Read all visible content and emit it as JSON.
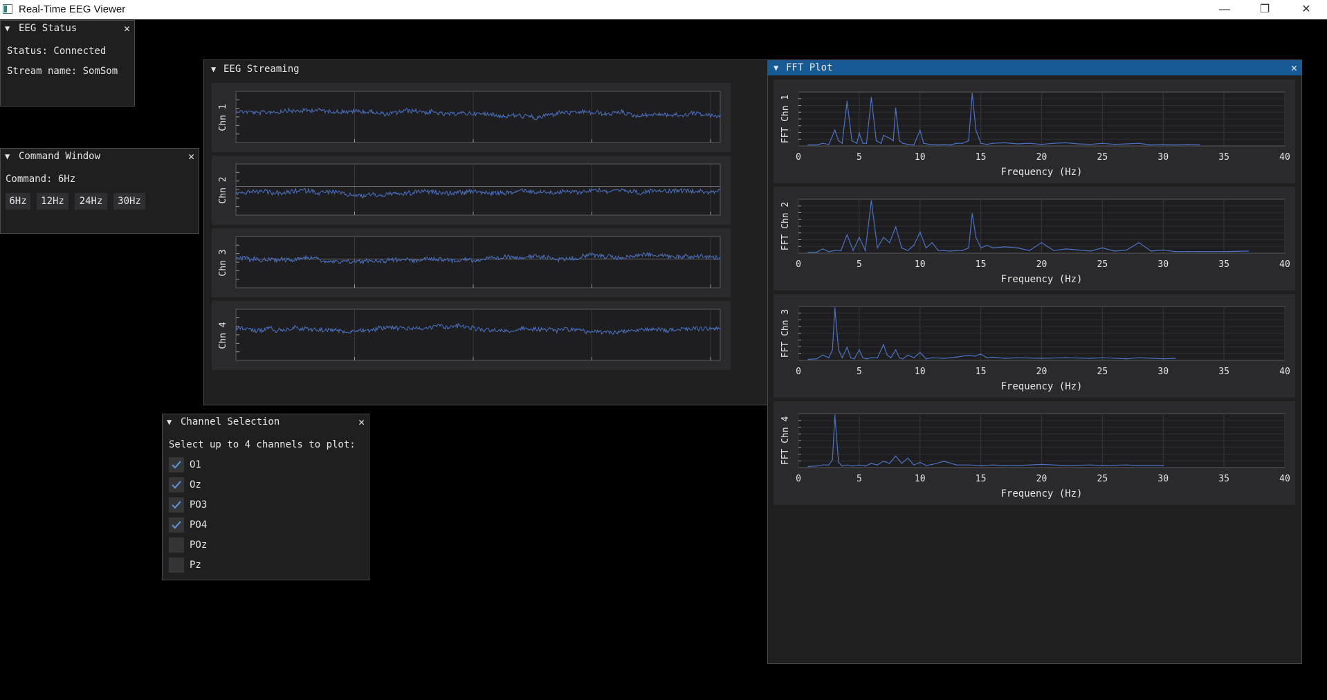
{
  "app": {
    "title": "Real-Time EEG Viewer"
  },
  "window_controls": {
    "minimize": "—",
    "restore": "❐",
    "close": "✕"
  },
  "eeg_status": {
    "title": "EEG Status",
    "status_text": "Status: Connected",
    "stream_text": "Stream name: SomSom"
  },
  "command_window": {
    "title": "Command Window",
    "command_text": "Command: 6Hz",
    "buttons": [
      "6Hz",
      "12Hz",
      "24Hz",
      "30Hz"
    ]
  },
  "eeg_streaming": {
    "title": "EEG Streaming",
    "channels": [
      "Chn 1",
      "Chn 2",
      "Chn 3",
      "Chn 4"
    ],
    "line_color": "#4c72c4"
  },
  "channel_selection": {
    "title": "Channel Selection",
    "prompt": "Select up to 4 channels to plot:",
    "channels": [
      {
        "label": "O1",
        "checked": true
      },
      {
        "label": "Oz",
        "checked": true
      },
      {
        "label": "PO3",
        "checked": true
      },
      {
        "label": "PO4",
        "checked": true
      },
      {
        "label": "POz",
        "checked": false
      },
      {
        "label": "Pz",
        "checked": false
      }
    ]
  },
  "fft_plot": {
    "title": "FFT Plot",
    "accent": "#185a93"
  },
  "chart_data": [
    {
      "type": "line",
      "ylabel": "FFT Chn 1",
      "xlabel": "Frequency (Hz)",
      "xlim": [
        0,
        40
      ],
      "xticks": [
        "0",
        "5",
        "10",
        "15",
        "20",
        "25",
        "30",
        "35",
        "40"
      ],
      "grid": true,
      "x": [
        0.8,
        1.5,
        2,
        2.5,
        3,
        3.3,
        3.6,
        4,
        4.4,
        4.8,
        5,
        5.3,
        5.6,
        6,
        6.4,
        6.8,
        7,
        7.5,
        7.8,
        8,
        8.3,
        8.6,
        9,
        9.5,
        10,
        10.3,
        10.8,
        11.5,
        12,
        12.5,
        13,
        13.5,
        14,
        14.3,
        14.6,
        15,
        15.5,
        16,
        17,
        18,
        19,
        20,
        21,
        22,
        23,
        24,
        25,
        26,
        27,
        28,
        29,
        30,
        31,
        32,
        33
      ],
      "y": [
        0.02,
        0.02,
        0.05,
        0.03,
        0.3,
        0.1,
        0.05,
        0.85,
        0.1,
        0.05,
        0.25,
        0.05,
        0.05,
        0.92,
        0.1,
        0.05,
        0.2,
        0.15,
        0.1,
        0.72,
        0.1,
        0.05,
        0.03,
        0.02,
        0.3,
        0.05,
        0.03,
        0.02,
        0.03,
        0.02,
        0.05,
        0.05,
        0.1,
        1.0,
        0.3,
        0.05,
        0.03,
        0.05,
        0.06,
        0.04,
        0.05,
        0.03,
        0.05,
        0.06,
        0.04,
        0.03,
        0.05,
        0.03,
        0.04,
        0.05,
        0.02,
        0.03,
        0.02,
        0.03,
        0.02
      ]
    },
    {
      "type": "line",
      "ylabel": "FFT Chn 2",
      "xlabel": "Frequency (Hz)",
      "xlim": [
        0,
        40
      ],
      "xticks": [
        "0",
        "5",
        "10",
        "15",
        "20",
        "25",
        "30",
        "35",
        "40"
      ],
      "grid": true,
      "x": [
        0.8,
        1.5,
        2,
        2.5,
        3,
        3.5,
        4,
        4.5,
        5,
        5.5,
        6,
        6.5,
        7,
        7.5,
        8,
        8.5,
        9,
        9.5,
        10,
        10.5,
        11,
        11.5,
        12,
        12.5,
        13,
        13.5,
        14,
        14.3,
        14.6,
        15,
        15.5,
        16,
        17,
        18,
        19,
        20,
        21,
        22,
        23,
        24,
        25,
        26,
        27,
        28,
        29,
        30,
        31,
        32,
        33,
        35,
        37
      ],
      "y": [
        0.02,
        0.02,
        0.08,
        0.03,
        0.05,
        0.05,
        0.35,
        0.05,
        0.3,
        0.05,
        1.0,
        0.1,
        0.3,
        0.2,
        0.5,
        0.1,
        0.05,
        0.15,
        0.4,
        0.1,
        0.2,
        0.05,
        0.05,
        0.04,
        0.05,
        0.05,
        0.1,
        0.75,
        0.3,
        0.1,
        0.15,
        0.1,
        0.12,
        0.1,
        0.05,
        0.2,
        0.05,
        0.08,
        0.06,
        0.04,
        0.1,
        0.04,
        0.06,
        0.2,
        0.04,
        0.06,
        0.03,
        0.03,
        0.03,
        0.03,
        0.04
      ]
    },
    {
      "type": "line",
      "ylabel": "FFT Chn 3",
      "xlabel": "Frequency (Hz)",
      "xlim": [
        0,
        40
      ],
      "xticks": [
        "0",
        "5",
        "10",
        "15",
        "20",
        "25",
        "30",
        "35",
        "40"
      ],
      "grid": true,
      "x": [
        0.8,
        1.5,
        2,
        2.5,
        2.8,
        3,
        3.3,
        3.6,
        4,
        4.3,
        4.6,
        5,
        5.3,
        5.6,
        6,
        6.5,
        7,
        7.3,
        7.6,
        8,
        8.3,
        8.6,
        9,
        9.5,
        10,
        10.5,
        11,
        12,
        13,
        14,
        14.5,
        15,
        15.5,
        16,
        17,
        18,
        20,
        22,
        24,
        25,
        27,
        28,
        30,
        31
      ],
      "y": [
        0.02,
        0.03,
        0.1,
        0.05,
        0.2,
        1.0,
        0.2,
        0.05,
        0.25,
        0.05,
        0.03,
        0.2,
        0.05,
        0.03,
        0.05,
        0.05,
        0.3,
        0.1,
        0.05,
        0.2,
        0.05,
        0.03,
        0.1,
        0.05,
        0.15,
        0.03,
        0.05,
        0.04,
        0.06,
        0.1,
        0.08,
        0.12,
        0.05,
        0.06,
        0.04,
        0.05,
        0.04,
        0.05,
        0.04,
        0.05,
        0.03,
        0.05,
        0.03,
        0.04
      ]
    },
    {
      "type": "line",
      "ylabel": "FFT Chn 4",
      "xlabel": "Frequency (Hz)",
      "xlim": [
        0,
        40
      ],
      "xticks": [
        "0",
        "5",
        "10",
        "15",
        "20",
        "25",
        "30",
        "35",
        "40"
      ],
      "grid": true,
      "x": [
        0.8,
        1.5,
        2,
        2.5,
        2.8,
        3,
        3.3,
        3.6,
        4,
        4.5,
        5,
        5.5,
        6,
        6.5,
        7,
        7.5,
        8,
        8.5,
        9,
        9.5,
        10,
        10.5,
        11,
        12,
        13,
        14,
        15,
        16,
        17,
        18,
        20,
        22,
        24,
        25,
        27,
        28,
        30
      ],
      "y": [
        0.02,
        0.03,
        0.05,
        0.05,
        0.15,
        1.0,
        0.1,
        0.03,
        0.05,
        0.03,
        0.05,
        0.03,
        0.08,
        0.05,
        0.12,
        0.08,
        0.22,
        0.08,
        0.18,
        0.05,
        0.1,
        0.04,
        0.06,
        0.12,
        0.05,
        0.05,
        0.04,
        0.05,
        0.04,
        0.04,
        0.06,
        0.04,
        0.05,
        0.04,
        0.05,
        0.04,
        0.04
      ]
    }
  ]
}
